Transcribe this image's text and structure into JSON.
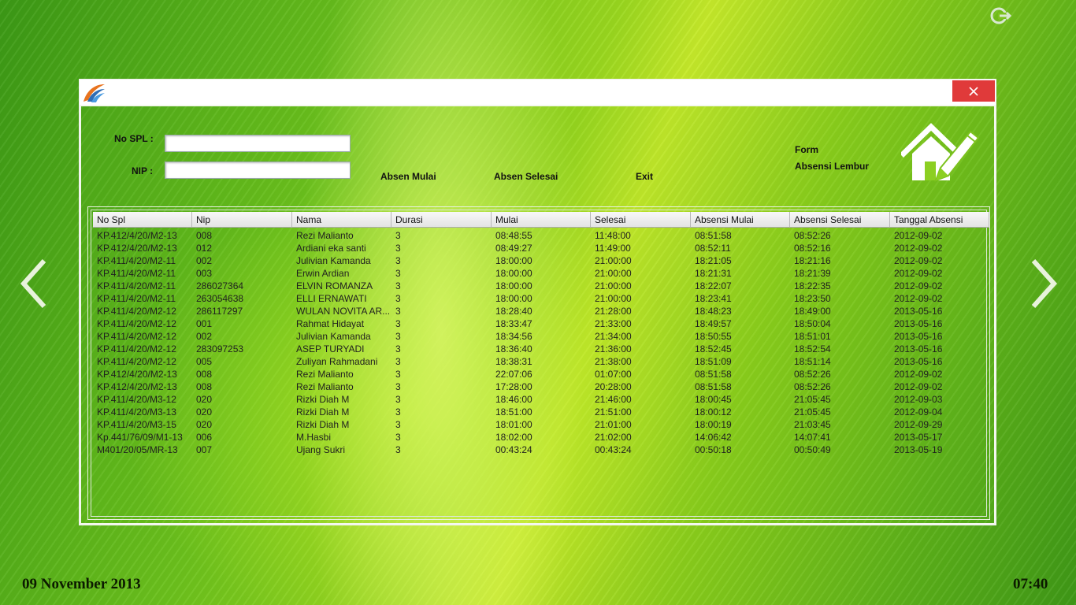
{
  "desktop": {
    "date": "09 November 2013",
    "time": "07:40",
    "icons": {
      "power": "power-icon",
      "prev": "chevron-left-icon",
      "next": "chevron-right-icon"
    }
  },
  "window": {
    "title": "",
    "close_icon": "close-icon",
    "form": {
      "no_spl_label": "No SPL :",
      "no_spl_value": "",
      "nip_label": "NIP :",
      "nip_value": "",
      "btn_absen_mulai": "Absen Mulai",
      "btn_absen_selesai": "Absen Selesai",
      "btn_exit": "Exit",
      "heading_line1": "Form",
      "heading_line2": "Absensi Lembur",
      "home_icon": "home-edit-icon"
    },
    "table": {
      "columns": [
        "No Spl",
        "Nip",
        "Nama",
        "Durasi",
        "Mulai",
        "Selesai",
        "Absensi Mulai",
        "Absensi Selesai",
        "Tanggal Absensi"
      ],
      "rows": [
        [
          "KP.412/4/20/M2-13",
          "008",
          "Rezi Malianto",
          "3",
          "08:48:55",
          "11:48:00",
          "08:51:58",
          "08:52:26",
          "2012-09-02"
        ],
        [
          "KP.412/4/20/M2-13",
          "012",
          "Ardiani eka santi",
          "3",
          "08:49:27",
          "11:49:00",
          "08:52:11",
          "08:52:16",
          "2012-09-02"
        ],
        [
          "KP.411/4/20/M2-11",
          "002",
          "Julivian Kamanda",
          "3",
          "18:00:00",
          "21:00:00",
          "18:21:05",
          "18:21:16",
          "2012-09-02"
        ],
        [
          "KP.411/4/20/M2-11",
          "003",
          "Erwin Ardian",
          "3",
          "18:00:00",
          "21:00:00",
          "18:21:31",
          "18:21:39",
          "2012-09-02"
        ],
        [
          "KP.411/4/20/M2-11",
          "286027364",
          "ELVIN ROMANZA",
          "3",
          "18:00:00",
          "21:00:00",
          "18:22:07",
          "18:22:35",
          "2012-09-02"
        ],
        [
          "KP.411/4/20/M2-11",
          "263054638",
          "ELLI ERNAWATI",
          "3",
          "18:00:00",
          "21:00:00",
          "18:23:41",
          "18:23:50",
          "2012-09-02"
        ],
        [
          "KP.411/4/20/M2-12",
          "286117297",
          "WULAN NOVITA AR...",
          "3",
          "18:28:40",
          "21:28:00",
          "18:48:23",
          "18:49:00",
          "2013-05-16"
        ],
        [
          "KP.411/4/20/M2-12",
          "001",
          "Rahmat Hidayat",
          "3",
          "18:33:47",
          "21:33:00",
          "18:49:57",
          "18:50:04",
          "2013-05-16"
        ],
        [
          "KP.411/4/20/M2-12",
          "002",
          "Julivian Kamanda",
          "3",
          "18:34:56",
          "21:34:00",
          "18:50:55",
          "18:51:01",
          "2013-05-16"
        ],
        [
          "KP.411/4/20/M2-12",
          "283097253",
          "ASEP TURYADI",
          "3",
          "18:36:40",
          "21:36:00",
          "18:52:45",
          "18:52:54",
          "2013-05-16"
        ],
        [
          "KP.411/4/20/M2-12",
          "005",
          "Zuliyan Rahmadani",
          "3",
          "18:38:31",
          "21:38:00",
          "18:51:09",
          "18:51:14",
          "2013-05-16"
        ],
        [
          "KP.412/4/20/M2-13",
          "008",
          "Rezi Malianto",
          "3",
          "22:07:06",
          "01:07:00",
          "08:51:58",
          "08:52:26",
          "2012-09-02"
        ],
        [
          "KP.412/4/20/M2-13",
          "008",
          "Rezi Malianto",
          "3",
          "17:28:00",
          "20:28:00",
          "08:51:58",
          "08:52:26",
          "2012-09-02"
        ],
        [
          "KP.411/4/20/M3-12",
          "020",
          "Rizki Diah M",
          "3",
          "18:46:00",
          "21:46:00",
          "18:00:45",
          "21:05:45",
          "2012-09-03"
        ],
        [
          "KP.411/4/20/M3-13",
          "020",
          "Rizki Diah M",
          "3",
          "18:51:00",
          "21:51:00",
          "18:00:12",
          "21:05:45",
          "2012-09-04"
        ],
        [
          "KP.411/4/20/M3-15",
          "020",
          "Rizki Diah M",
          "3",
          "18:01:00",
          "21:01:00",
          "18:00:19",
          "21:03:45",
          "2012-09-29"
        ],
        [
          "Kp.441/76/09/M1-13",
          "006",
          "M.Hasbi",
          "3",
          "18:02:00",
          "21:02:00",
          "14:06:42",
          "14:07:41",
          "2013-05-17"
        ],
        [
          "M401/20/05/MR-13",
          "007",
          "Ujang Sukri",
          "3",
          "00:43:24",
          "00:43:24",
          "00:50:18",
          "00:50:49",
          "2013-05-19"
        ]
      ]
    }
  }
}
